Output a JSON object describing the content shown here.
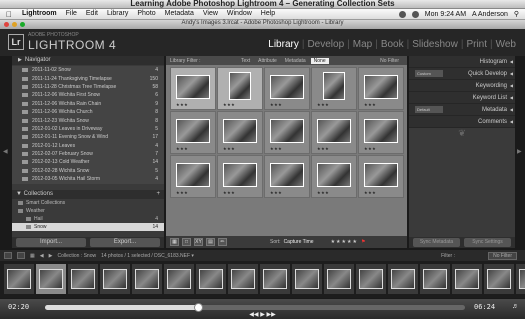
{
  "window_title": "Learning Adobe Photoshop Lightroom 4 – Generating Collection Sets",
  "menubar": {
    "items": [
      "Lightroom",
      "File",
      "Edit",
      "Library",
      "Photo",
      "Metadata",
      "View",
      "Window",
      "Help"
    ],
    "clock": "Mon 9:24 AM",
    "user": "A Anderson"
  },
  "lr_window_title": "Andy's Images 3.lrcat - Adobe Photoshop Lightroom - Library",
  "identity": {
    "logo": "Lr",
    "subtitle": "ADOBE PHOTOSHOP",
    "name": "LIGHTROOM 4"
  },
  "modules": [
    "Library",
    "Develop",
    "Map",
    "Book",
    "Slideshow",
    "Print",
    "Web"
  ],
  "left_panel": {
    "navigator_label": "Navigator",
    "folders": [
      {
        "name": "2011-11-02 Snow",
        "count": "4"
      },
      {
        "name": "2011-11-24 Thanksgiving Timelapse",
        "count": "150"
      },
      {
        "name": "2011-11-28 Christmas Tree Timelapse",
        "count": "58"
      },
      {
        "name": "2011-12-06 Wichita First Snow",
        "count": "6"
      },
      {
        "name": "2011-12-06 Wichita Rain Chain",
        "count": "9"
      },
      {
        "name": "2011-12-06 Wichita Church",
        "count": "8"
      },
      {
        "name": "2011-12-23 Wichita Snow",
        "count": "8"
      },
      {
        "name": "2012-01-02 Leaves in Driveway",
        "count": "5"
      },
      {
        "name": "2012-01-11 Evening Snow & Wind",
        "count": "17"
      },
      {
        "name": "2012-01-12 Leaves",
        "count": "4"
      },
      {
        "name": "2012-02-07 February Snow",
        "count": "7"
      },
      {
        "name": "2012-02-13 Cold Weather",
        "count": "14"
      },
      {
        "name": "2012-02-28 Wichita Snow",
        "count": "5"
      },
      {
        "name": "2012-03-05 Wichita Hail Storm",
        "count": "4"
      }
    ],
    "collections_label": "Collections",
    "collections": [
      {
        "name": "Smart Collections",
        "count": ""
      },
      {
        "name": "Weather",
        "count": ""
      },
      {
        "name": "Hail",
        "count": "4"
      },
      {
        "name": "Snow",
        "count": "14"
      }
    ],
    "import_label": "Import...",
    "export_label": "Export..."
  },
  "library_filter": {
    "label": "Library Filter :",
    "options": [
      "Text",
      "Attribute",
      "Metadata",
      "None"
    ],
    "active": "None",
    "preset": "No Filter"
  },
  "grid": {
    "stars": "★★★",
    "cells": [
      {
        "sel": true,
        "portrait": false
      },
      {
        "sel": true,
        "portrait": true
      },
      {
        "sel": false,
        "portrait": false
      },
      {
        "sel": false,
        "portrait": true
      },
      {
        "sel": false,
        "portrait": false
      },
      {
        "sel": false,
        "portrait": false
      },
      {
        "sel": false,
        "portrait": false
      },
      {
        "sel": false,
        "portrait": false
      },
      {
        "sel": false,
        "portrait": false
      },
      {
        "sel": false,
        "portrait": false
      },
      {
        "sel": false,
        "portrait": false
      },
      {
        "sel": false,
        "portrait": false
      },
      {
        "sel": false,
        "portrait": false
      },
      {
        "sel": false,
        "portrait": false
      },
      {
        "sel": false,
        "portrait": false
      }
    ]
  },
  "toolbar": {
    "sort_label": "Sort:",
    "sort_value": "Capture Time",
    "rating": "★★★★★"
  },
  "right_panel": {
    "sections": [
      "Histogram",
      "Quick Develop",
      "Keywording",
      "Keyword List",
      "Metadata",
      "Comments"
    ],
    "preset_quick": "Custom",
    "preset_meta": "Default",
    "sync_metadata": "Sync Metadata",
    "sync_settings": "Sync Settings"
  },
  "filmstrip_bar": {
    "source": "Collection : Snow",
    "info": "14 photos / 1 selected / DSC_6183.NEF ▾",
    "filter_label": "Filter :",
    "filter_value": "No Filter"
  },
  "filmstrip_count": 17,
  "video": {
    "elapsed": "02:20",
    "total": "06:24",
    "progress": 0.365
  }
}
